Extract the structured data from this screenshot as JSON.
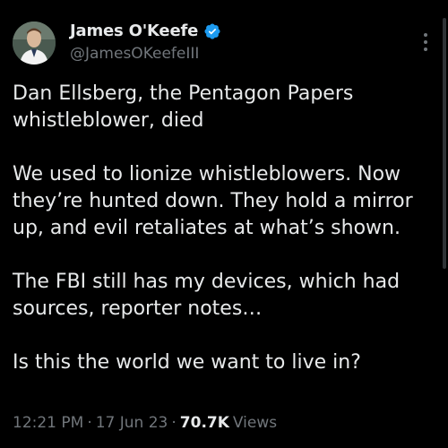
{
  "author": {
    "display_name": "James O'Keefe",
    "handle": "@JamesOKeefeIII",
    "verified": true,
    "verified_icon": "verified-badge-icon",
    "avatar_icon": "avatar"
  },
  "tweet": {
    "text": "Dan Ellsberg, the Pentagon Papers whistleblower, died\n\nWe used to lionize whistleblowers. Now they’re hunted down. They hold a mirror up, and evil retaliates at what’s shown.\n\nThe FBI still has my devices, which had sources, reporter notes…\n\nIs this the world we want to live in?"
  },
  "meta": {
    "time": "12:21 PM",
    "separator": "·",
    "date": "17 Jun 23",
    "views_count": "70.7K",
    "views_label": "Views"
  },
  "colors": {
    "background": "#000000",
    "text": "#e7e9ea",
    "secondary": "#71767b",
    "verified": "#1d9bf0"
  },
  "icons": {
    "more": "more-options-icon"
  }
}
